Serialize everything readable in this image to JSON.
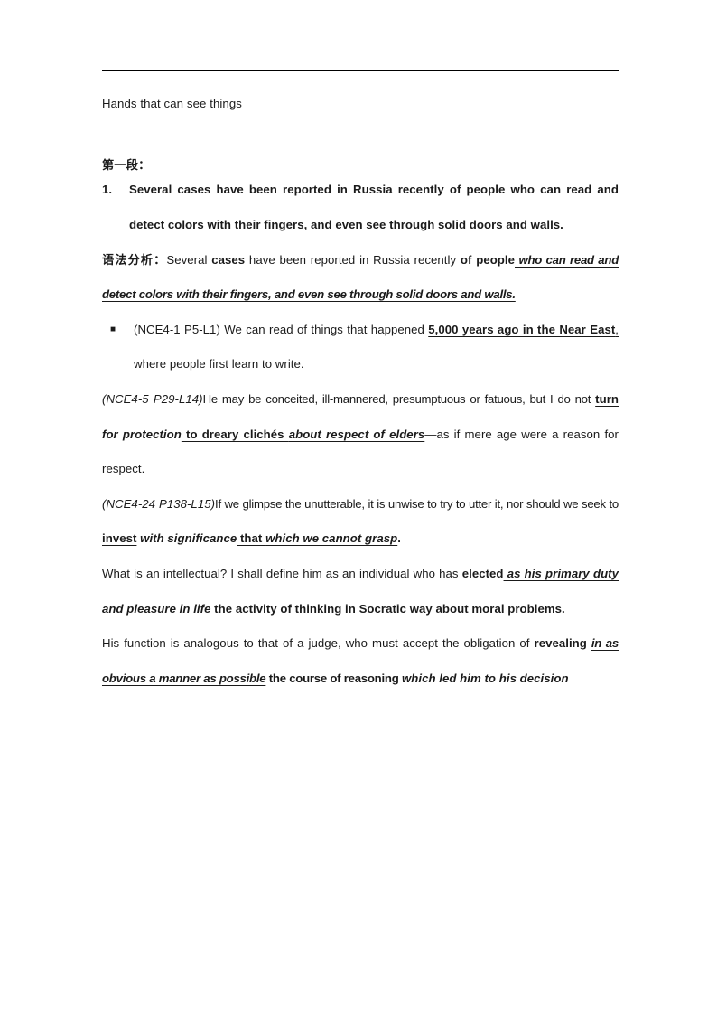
{
  "document": {
    "title": "Hands that can see things",
    "section_heading": "第一段：",
    "bullet_glyph": "■",
    "list_marker_1": "1."
  },
  "paragraphs": {
    "numbered_item": {
      "marker": "1.",
      "text": "Several cases have been reported in Russia recently of people who can read and detect colors with their fingers, and even see through solid doors and walls."
    },
    "grammar_analysis": {
      "label": "语法分析：",
      "run1": "Several ",
      "run2_bold": "cases",
      "run3": " have been reported in Russia recently ",
      "run4_bold": "of people",
      "run5_bold_italic_underline": " who can read and detect colors with their fingers, and even see through solid doors and walls."
    },
    "bullet_item": {
      "citation": "(NCE4-1 P5-L1)",
      "run1": " We can read of things that happened ",
      "run2_bold_underline": "5,000 years ago in the Near East",
      "run3_underline": ", where people first learn to write."
    },
    "quote_elders": {
      "citation": "(NCE4-5 P29-L14)",
      "run1": "He may be conceited, ill-mannered, presumptuous or fatuous, but I do not ",
      "run2_bold_underline": "turn",
      "run3_bold_italic": " for protection",
      "run4_bold_underline": " to dreary clichés ",
      "run5_bold_italic_underline": "about respect of elders",
      "run6": "—as if mere age were a reason for respect."
    },
    "quote_unutterable": {
      "citation": "(NCE4-24 P138-L15)",
      "run1": "If we glimpse the unutterable, it is unwise to try to utter it, nor should we seek to ",
      "run2_bold_underline": "invest",
      "run3_bold_italic": " with significance",
      "run4_bold_underline": " that ",
      "run5_bold_italic_underline": "which we cannot grasp",
      "run6": "."
    },
    "quote_intellectual": {
      "run1": "What is an intellectual? I shall define him as an individual who has ",
      "run2_bold": "elected",
      "run3_bold_italic_underline": " as  his primary duty and pleasure in life",
      "run4_bold": " the activity of thinking in Socratic way about moral problems."
    },
    "quote_judge": {
      "run1": "His function is analogous to  that of  a  judge, who  must accept the  obligation of ",
      "run2_bold": "revealing ",
      "run3_bold_italic_underline": "in as obvious a manner as possible",
      "run4_bold": " the course of reasoning ",
      "run5_bold_italic": "which led him to his decision",
      "run6_bold": "."
    }
  },
  "colors": {
    "text": "#1a1a1a",
    "rule": "#000000",
    "background": "#ffffff"
  }
}
